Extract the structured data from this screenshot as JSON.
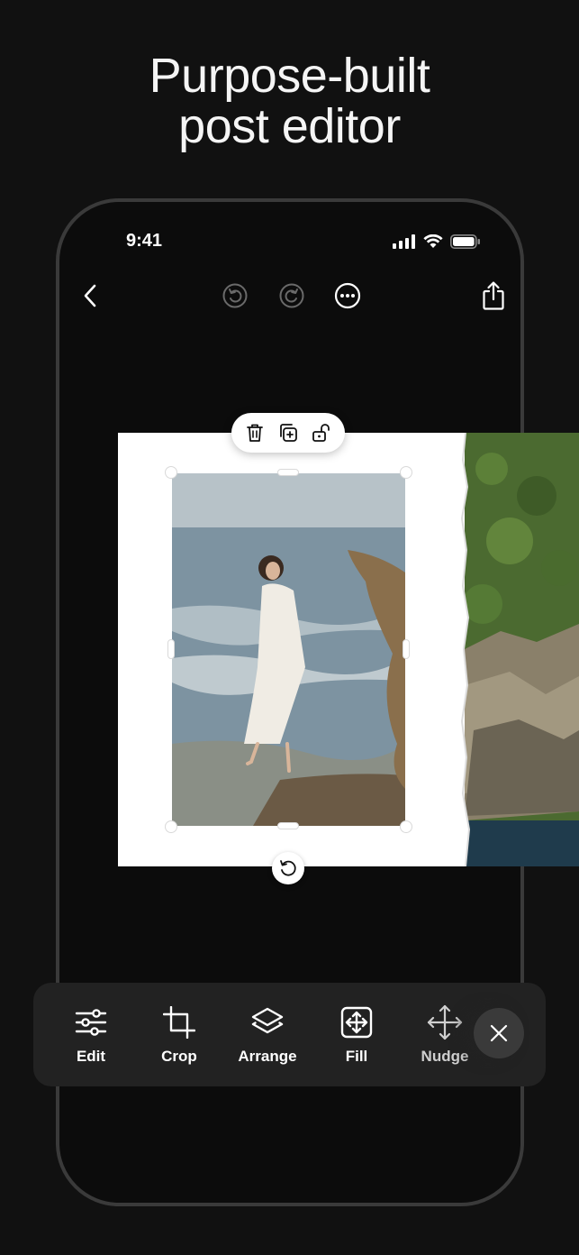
{
  "headline": {
    "line1": "Purpose-built",
    "line2": "post editor"
  },
  "status_bar": {
    "time": "9:41",
    "icons": [
      "cellular-signal-icon",
      "wifi-icon",
      "battery-icon"
    ]
  },
  "top_bar": {
    "icons": [
      "back-chevron-icon",
      "undo-icon",
      "redo-icon",
      "more-options-icon",
      "share-icon"
    ]
  },
  "selection_pill": {
    "icons": [
      "trash-icon",
      "duplicate-icon",
      "unlock-icon"
    ]
  },
  "rotate": {
    "icon": "rotate-icon"
  },
  "toolbar": {
    "tools": [
      {
        "label": "Edit",
        "icon": "sliders-icon"
      },
      {
        "label": "Crop",
        "icon": "crop-icon"
      },
      {
        "label": "Arrange",
        "icon": "layers-icon"
      },
      {
        "label": "Fill",
        "icon": "fill-icon"
      },
      {
        "label": "Nudge",
        "icon": "move-arrows-icon"
      }
    ],
    "close_icon": "close-icon"
  },
  "colors": {
    "background": "#111111",
    "phone_frame": "#3a3a3a",
    "toolbar_bg": "#222222",
    "close_bg": "#3a3a3a",
    "sheet": "#ffffff"
  }
}
